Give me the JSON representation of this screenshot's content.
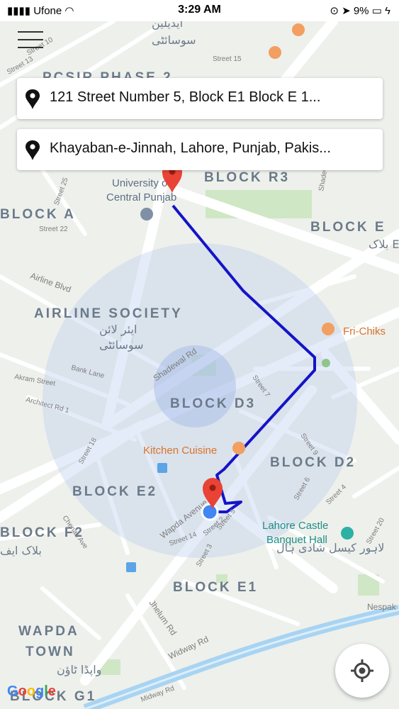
{
  "status_bar": {
    "carrier": "Ufone",
    "time": "3:29 AM",
    "battery": "9%"
  },
  "origin_text": "121 Street Number 5, Block E1 Block E 1...",
  "destination_text": "Khayaban-e-Jinnah, Lahore, Punjab, Pakis...",
  "colors": {
    "route": "#1414c8",
    "marker": "#e94335",
    "user_dot": "#4285f4",
    "accuracy_circle": "#b5c8ee",
    "water": "#a8d4f2",
    "park": "#cfe7c4"
  },
  "icons": [
    "menu-icon",
    "location-pin-icon",
    "marker-icon",
    "my-location-icon",
    "restaurant-icon",
    "bus-stop-icon",
    "school-icon",
    "wedding-hall-icon"
  ],
  "map": {
    "areas": [
      "PCSIR PHASE 2",
      "BLOCK R3",
      "BLOCK E",
      "BLOCK A",
      "AIRLINE SOCIETY",
      "BLOCK D3",
      "BLOCK D2",
      "BLOCK E2",
      "BLOCK F2",
      "BLOCK E1",
      "WAPDA",
      "TOWN",
      "BLOCK G1"
    ],
    "urdu_labels": [
      "ایڈیلین",
      "سوسائٹی",
      "بلاک E",
      "ایئر لائن",
      "سوسائٹی",
      "بلاک ایف",
      "واپڈا ٹاؤن",
      "لاہور کیسل شادی ہال"
    ],
    "places": [
      "University of Central Punjab",
      "Fri-Chiks",
      "Kitchen Cuisine",
      "Lahore Castle Banquet Hall"
    ],
    "streets": [
      "Street 15",
      "Street 10",
      "Street 13",
      "Street 25",
      "Street 22",
      "Airline Blvd",
      "Shadewal Rd",
      "Bank Lane",
      "Akram Street",
      "Architect Rd 1",
      "Street 7",
      "Street 9",
      "Street 18",
      "Street 6",
      "Street 4",
      "Street 20",
      "Wapda Avenue",
      "Street 5",
      "Street 2",
      "Street 14",
      "Street 3",
      "Chenab Ave",
      "Jhelum Rd",
      "Widway Rd",
      "Midway Rd",
      "Nespak",
      "Shadewal"
    ],
    "attribution": "Google"
  }
}
